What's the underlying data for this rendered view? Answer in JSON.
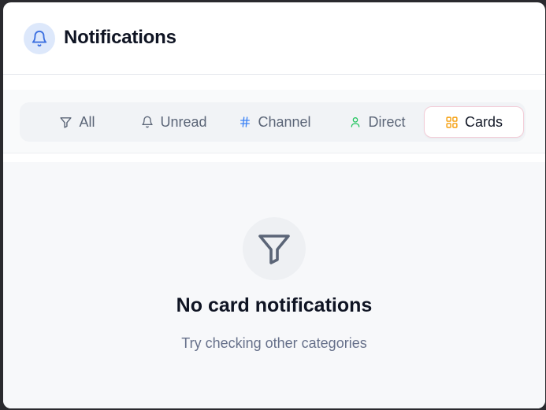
{
  "header": {
    "title": "Notifications",
    "icon": "bell-icon",
    "accent": "#3b6fe0"
  },
  "tabs": [
    {
      "label": "All",
      "icon": "filter-icon",
      "color": "#5b6577",
      "active": false
    },
    {
      "label": "Unread",
      "icon": "bell-icon",
      "color": "#5b6577",
      "active": false
    },
    {
      "label": "Channel",
      "icon": "hash-icon",
      "color": "#3b82f6",
      "active": false
    },
    {
      "label": "Direct",
      "icon": "user-icon",
      "color": "#22c55e",
      "active": false
    },
    {
      "label": "Cards",
      "icon": "grid-icon",
      "color": "#f59e0b",
      "active": true
    }
  ],
  "empty_state": {
    "icon": "filter-icon",
    "title": "No card notifications",
    "subtitle": "Try checking other categories"
  }
}
